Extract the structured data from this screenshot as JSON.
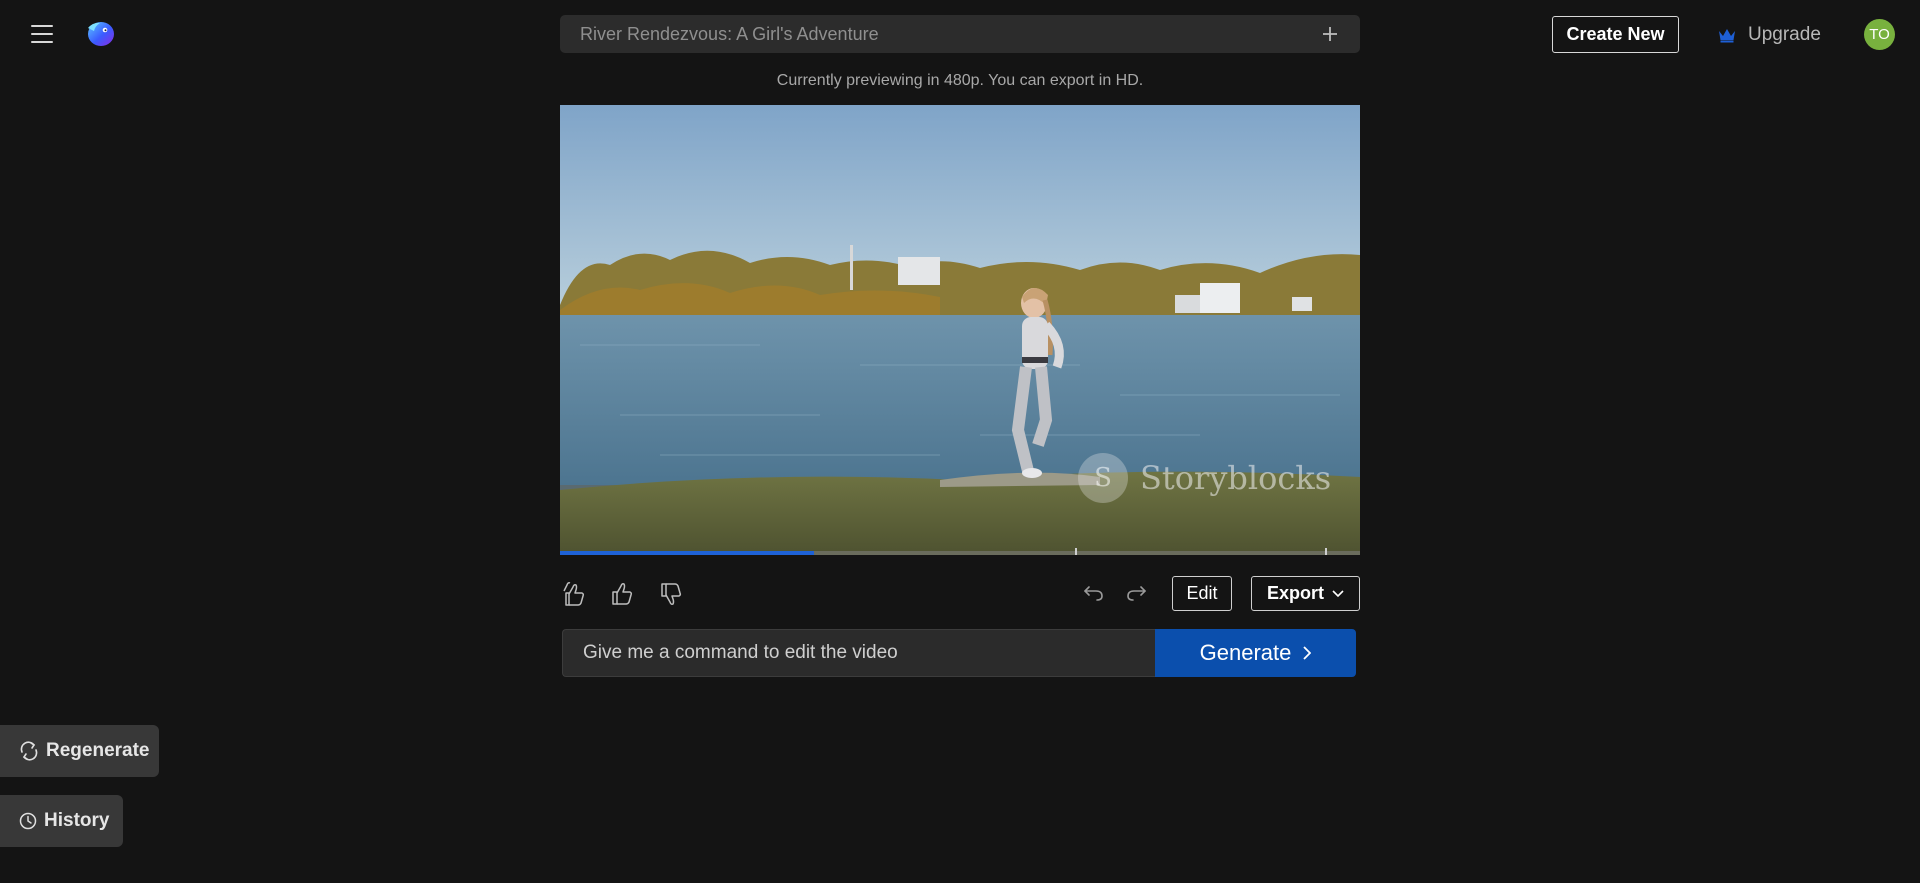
{
  "header": {
    "menu_icon": "hamburger-menu-icon",
    "logo_icon": "app-logo-icon",
    "project_title": "River Rendezvous: A Girl's Adventure",
    "add_icon": "plus-icon",
    "create_new_label": "Create New",
    "upgrade_label": "Upgrade",
    "upgrade_icon": "crown-icon",
    "avatar_initials": "TO",
    "avatar_color": "#78b13e"
  },
  "preview": {
    "note": "Currently previewing in 480p. You can export in HD.",
    "watermark_text": "Storyblocks",
    "watermark_mark": "S",
    "progress_fraction": 0.318,
    "progress_color": "#1e62d6"
  },
  "toolbar": {
    "feedback_icons": [
      "double-thumbs-up-icon",
      "thumbs-up-icon",
      "thumbs-down-icon"
    ],
    "undo_icon": "undo-icon",
    "redo_icon": "redo-icon",
    "edit_label": "Edit",
    "export_label": "Export",
    "export_icon": "chevron-down-icon"
  },
  "command": {
    "placeholder": "Give me a command to edit the video",
    "value": "",
    "generate_label": "Generate",
    "generate_icon": "chevron-right-icon",
    "accent_color": "#0b4fad"
  },
  "sidebar": {
    "regenerate_label": "Regenerate",
    "regenerate_icon": "refresh-icon",
    "history_label": "History",
    "history_icon": "clock-icon"
  }
}
